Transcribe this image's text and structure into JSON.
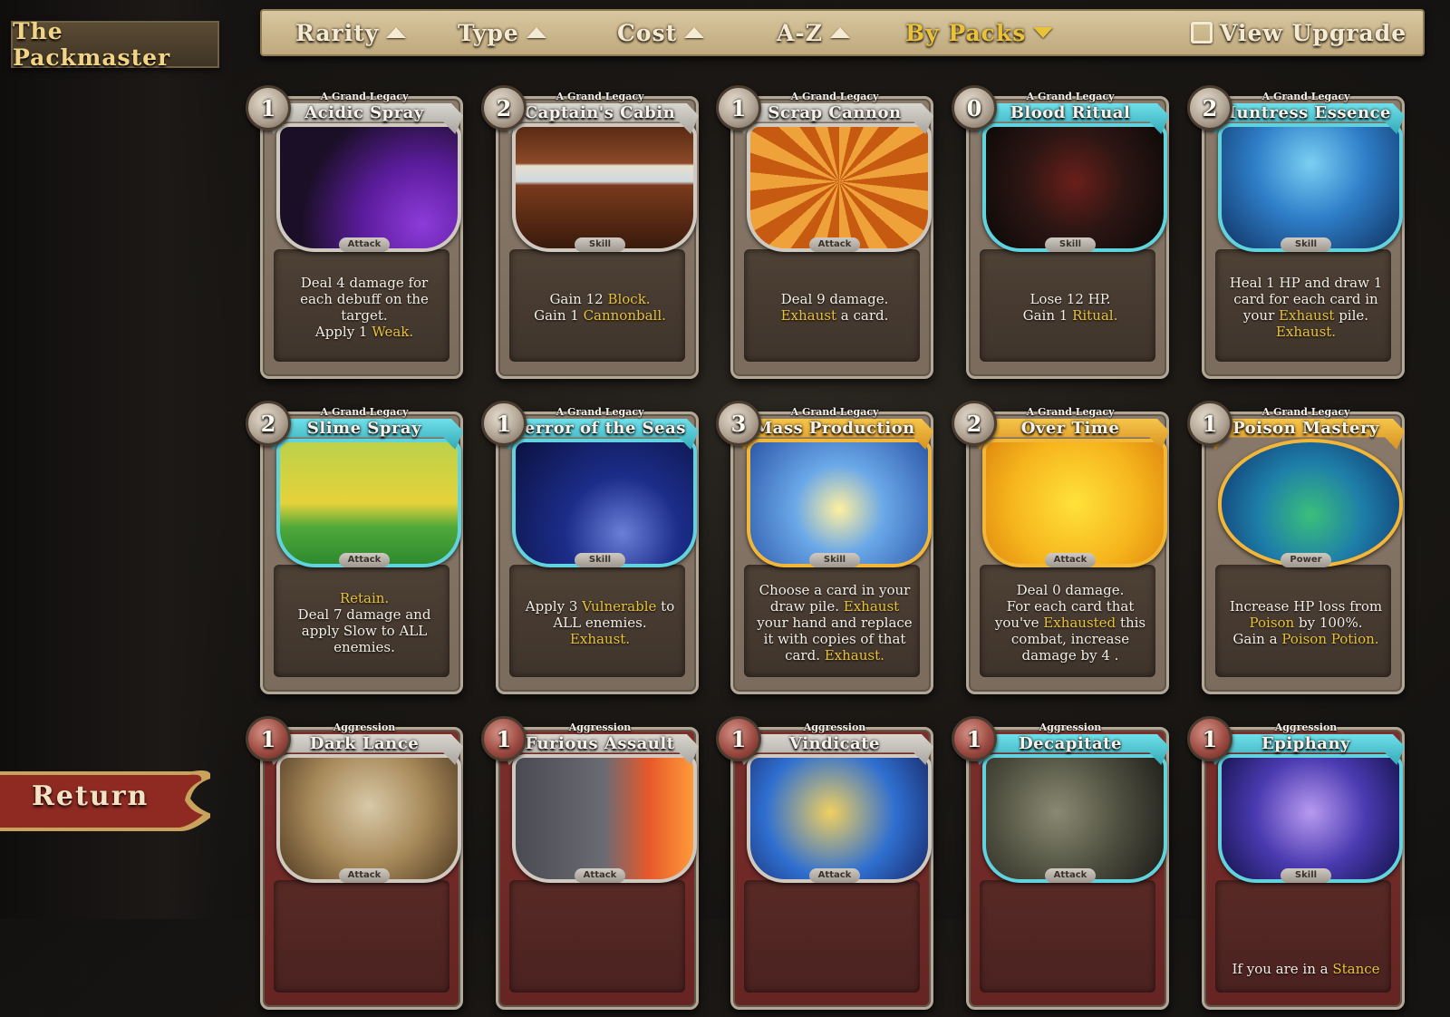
{
  "app": {
    "title": "The Packmaster"
  },
  "sort_bar": {
    "items": [
      {
        "label": "Rarity",
        "direction": "up",
        "active": false
      },
      {
        "label": "Type",
        "direction": "up",
        "active": false
      },
      {
        "label": "Cost",
        "direction": "up",
        "active": false
      },
      {
        "label": "A-Z",
        "direction": "up",
        "active": false
      },
      {
        "label": "By Packs",
        "direction": "down",
        "active": true
      }
    ],
    "view_upgrade_label": "View Upgrade",
    "view_upgrade_checked": false
  },
  "return_label": "Return",
  "colors": {
    "keyword": "#e9c23a",
    "active_sort": "#e9c23a",
    "uncommon_frame": "#5fd4df",
    "rare_frame": "#f2b738"
  },
  "cards": [
    {
      "pack": "A Grand Legacy",
      "name": "Acidic Spray",
      "cost": "1",
      "type": "Attack",
      "rarity": "common",
      "art": "acid-spray-art",
      "desc": [
        [
          {
            "t": "Deal 4 damage for"
          }
        ],
        [
          {
            "t": "each debuff on the"
          }
        ],
        [
          {
            "t": "target."
          }
        ],
        [
          {
            "t": "Apply 1 "
          },
          {
            "t": "Weak.",
            "k": true
          }
        ]
      ]
    },
    {
      "pack": "A Grand Legacy",
      "name": "Captain's Cabin",
      "cost": "2",
      "type": "Skill",
      "rarity": "common",
      "art": "ship-cabin-art",
      "desc": [
        [
          {
            "t": "Gain 12 "
          },
          {
            "t": "Block.",
            "k": true
          }
        ],
        [
          {
            "t": "Gain 1 "
          },
          {
            "t": "Cannonball.",
            "k": true
          }
        ]
      ]
    },
    {
      "pack": "A Grand Legacy",
      "name": "Scrap Cannon",
      "cost": "1",
      "type": "Attack",
      "rarity": "common",
      "art": "scrap-cannon-art",
      "desc": [
        [
          {
            "t": "Deal 9 damage."
          }
        ],
        [
          {
            "t": "Exhaust",
            "k": true
          },
          {
            "t": " a card."
          }
        ]
      ]
    },
    {
      "pack": "A Grand Legacy",
      "name": "Blood Ritual",
      "cost": "0",
      "type": "Skill",
      "rarity": "uncommon",
      "art": "blood-ritual-art",
      "desc": [
        [
          {
            "t": "Lose 12 HP."
          }
        ],
        [
          {
            "t": "Gain 1 "
          },
          {
            "t": "Ritual.",
            "k": true
          }
        ]
      ]
    },
    {
      "pack": "A Grand Legacy",
      "name": "Huntress Essence",
      "cost": "2",
      "type": "Skill",
      "rarity": "uncommon",
      "art": "huntress-mask-art",
      "desc": [
        [
          {
            "t": "Heal 1 HP and draw 1"
          }
        ],
        [
          {
            "t": "card for each card in"
          }
        ],
        [
          {
            "t": "your "
          },
          {
            "t": "Exhaust",
            "k": true
          },
          {
            "t": " pile."
          }
        ],
        [
          {
            "t": "Exhaust.",
            "k": true
          }
        ]
      ]
    },
    {
      "pack": "A Grand Legacy",
      "name": "Slime Spray",
      "cost": "2",
      "type": "Attack",
      "rarity": "uncommon",
      "art": "spray-bottle-art",
      "desc": [
        [
          {
            "t": "Retain.",
            "k": true
          }
        ],
        [
          {
            "t": "Deal 7 damage and"
          }
        ],
        [
          {
            "t": "apply Slow to ALL"
          }
        ],
        [
          {
            "t": "enemies."
          }
        ]
      ]
    },
    {
      "pack": "A Grand Legacy",
      "name": "Terror of the Seas",
      "cost": "1",
      "type": "Skill",
      "rarity": "uncommon",
      "art": "pirate-ship-art",
      "desc": [
        [
          {
            "t": "Apply 3 "
          },
          {
            "t": "Vulnerable",
            "k": true
          },
          {
            "t": " to"
          }
        ],
        [
          {
            "t": "ALL enemies."
          }
        ],
        [
          {
            "t": "Exhaust.",
            "k": true
          }
        ]
      ]
    },
    {
      "pack": "A Grand Legacy",
      "name": "Mass Production",
      "cost": "3",
      "type": "Skill",
      "rarity": "rare",
      "art": "mass-production-art",
      "desc": [
        [
          {
            "t": "Choose a card in your"
          }
        ],
        [
          {
            "t": "draw pile. "
          },
          {
            "t": "Exhaust",
            "k": true
          }
        ],
        [
          {
            "t": "your hand and replace"
          }
        ],
        [
          {
            "t": "it with copies of that"
          }
        ],
        [
          {
            "t": "card. "
          },
          {
            "t": "Exhaust.",
            "k": true
          }
        ]
      ]
    },
    {
      "pack": "A Grand Legacy",
      "name": "Over Time",
      "cost": "2",
      "type": "Attack",
      "rarity": "rare",
      "art": "over-time-art",
      "desc": [
        [
          {
            "t": "Deal 0 damage."
          }
        ],
        [
          {
            "t": "For each card that"
          }
        ],
        [
          {
            "t": "you've "
          },
          {
            "t": "Exhausted",
            "k": true
          },
          {
            "t": " this"
          }
        ],
        [
          {
            "t": "combat, increase"
          }
        ],
        [
          {
            "t": "damage by 4 ."
          }
        ]
      ]
    },
    {
      "pack": "A Grand Legacy",
      "name": "Poison Mastery",
      "cost": "1",
      "type": "Power",
      "rarity": "rare",
      "art": "poison-creature-art",
      "round_art": true,
      "desc": [
        [
          {
            "t": "Increase HP loss from"
          }
        ],
        [
          {
            "t": "Poison",
            "k": true
          },
          {
            "t": " by 100%."
          }
        ],
        [
          {
            "t": "Gain a "
          },
          {
            "t": "Poison Potion.",
            "k": true
          }
        ]
      ]
    },
    {
      "pack": "Aggression",
      "name": "Dark Lance",
      "cost": "1",
      "type": "Attack",
      "rarity": "common",
      "curse": true,
      "art": "dark-lance-art",
      "desc": []
    },
    {
      "pack": "Aggression",
      "name": "Furious Assault",
      "cost": "1",
      "type": "Attack",
      "rarity": "common",
      "curse": true,
      "art": "furious-assault-art",
      "desc": []
    },
    {
      "pack": "Aggression",
      "name": "Vindicate",
      "cost": "1",
      "type": "Attack",
      "rarity": "common",
      "curse": true,
      "art": "vindicate-art",
      "desc": []
    },
    {
      "pack": "Aggression",
      "name": "Decapitate",
      "cost": "1",
      "type": "Attack",
      "rarity": "uncommon",
      "curse": true,
      "art": "decapitate-art",
      "desc": []
    },
    {
      "pack": "Aggression",
      "name": "Epiphany",
      "cost": "1",
      "type": "Skill",
      "rarity": "uncommon",
      "curse": true,
      "art": "epiphany-art",
      "desc": [
        [
          {
            "t": "If you are in a "
          },
          {
            "t": "Stance",
            "k": true
          }
        ]
      ]
    }
  ]
}
